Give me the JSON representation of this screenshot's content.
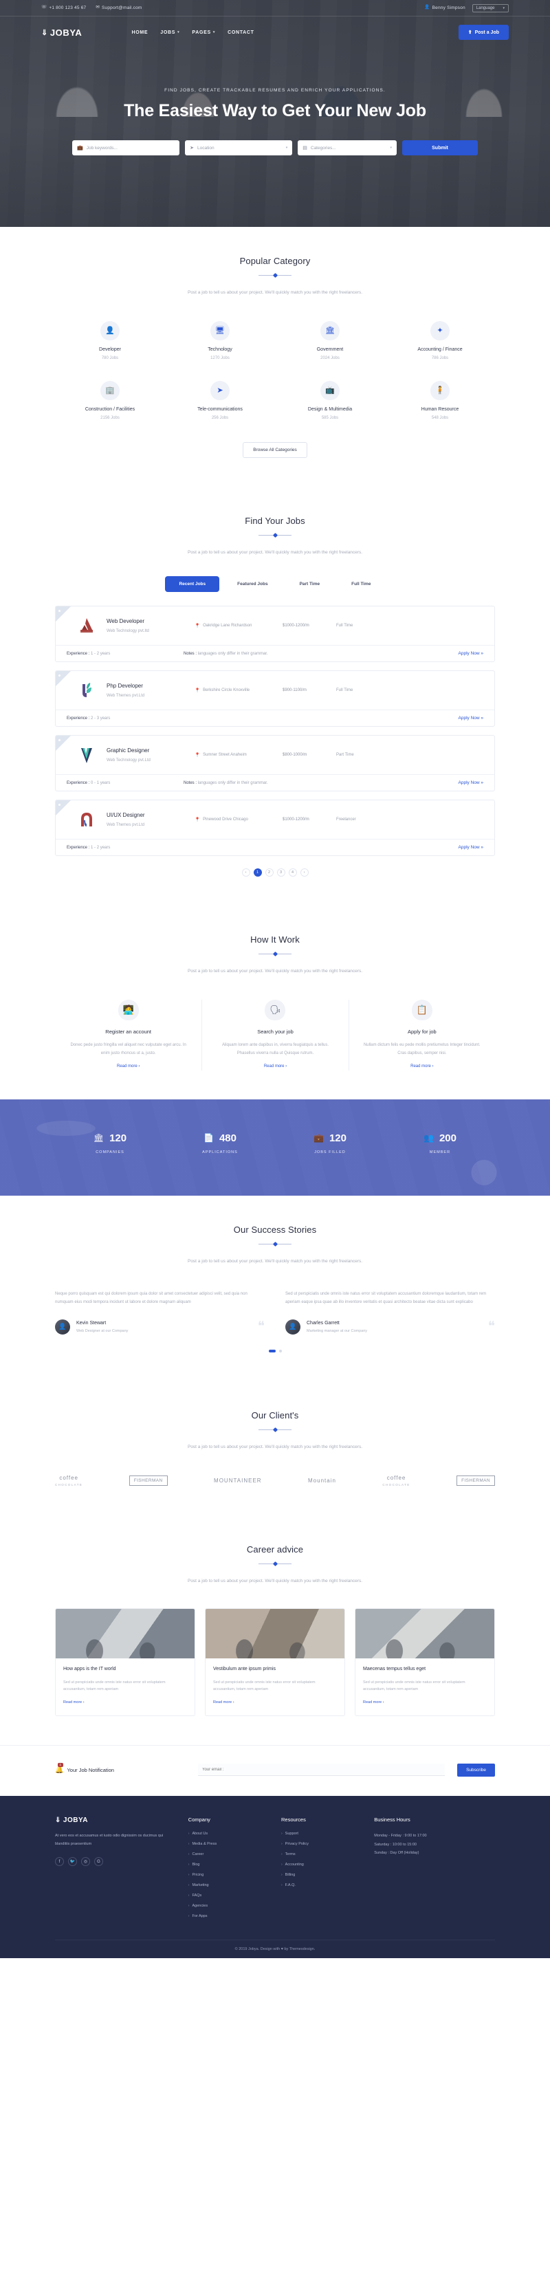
{
  "topbar": {
    "phone": "+1 800 123 45 67",
    "email": "Support@mail.com",
    "user": "Benny Simpson",
    "language": "Language"
  },
  "nav": {
    "brand": "JOBYA",
    "items": [
      {
        "label": "HOME",
        "has_caret": false
      },
      {
        "label": "JOBS",
        "has_caret": true
      },
      {
        "label": "PAGES",
        "has_caret": true
      },
      {
        "label": "CONTACT",
        "has_caret": false
      }
    ],
    "post_job": "Post a Job"
  },
  "hero": {
    "eyebrow": "FIND JOBS, CREATE TRACKABLE RESUMES AND ENRICH YOUR APPLICATIONS.",
    "title": "The Easiest Way to Get Your New Job",
    "search": {
      "keyword_placeholder": "Job keywords...",
      "location_placeholder": "Location",
      "category_placeholder": "Categories...",
      "submit": "Submit"
    }
  },
  "categories": {
    "title": "Popular Category",
    "subtitle": "Post a job to tell us about your project. We'll quickly match you with the right freelancers.",
    "browse_label": "Browse All Categories",
    "items": [
      {
        "name": "Developer",
        "count": "780 Jobs",
        "icon": "user-icon"
      },
      {
        "name": "Technology",
        "count": "1270 Jobs",
        "icon": "laptop-icon"
      },
      {
        "name": "Government",
        "count": "2024 Jobs",
        "icon": "bank-icon"
      },
      {
        "name": "Accounting / Finance",
        "count": "786 Jobs",
        "icon": "wand-icon"
      },
      {
        "name": "Construction / Facilities",
        "count": "2156 Jobs",
        "icon": "building-icon"
      },
      {
        "name": "Tele-communications",
        "count": "256 Jobs",
        "icon": "paper-plane-icon"
      },
      {
        "name": "Design & Multimedia",
        "count": "585 Jobs",
        "icon": "tv-icon"
      },
      {
        "name": "Human Resource",
        "count": "548 Jobs",
        "icon": "accessibility-icon"
      }
    ]
  },
  "jobs": {
    "title": "Find Your Jobs",
    "subtitle": "Post a job to tell us about your project. We'll quickly match you with the right freelancers.",
    "tabs": [
      "Recent Jobs",
      "Featured Jobs",
      "Part Time",
      "Full Time"
    ],
    "active_tab": "Recent Jobs",
    "apply_label": "Apply Now",
    "experience_label": "Experience :",
    "notes_label": "Notes :",
    "items": [
      {
        "title": "Web Developer",
        "company": "Web Technology pvt.ltd",
        "location": "Oakridge Lane Richardson",
        "salary": "$1000-1200/m",
        "type": "Full Time",
        "experience": "1 - 2 years",
        "notes": "languages only differ in their grammar.",
        "logo_color": "#a8403c"
      },
      {
        "title": "Php Developer",
        "company": "Web Themes pvt.Ltd",
        "location": "Berkshire Circle Knoxville",
        "salary": "$900-1100/m",
        "type": "Full Time",
        "experience": "2 - 3 years",
        "notes": "",
        "logo_color": "#3fbfae"
      },
      {
        "title": "Graphic Designer",
        "company": "Web Technology pvt.Ltd",
        "location": "Sumner Street Anaheim",
        "salary": "$800-1000/m",
        "type": "Part Time",
        "experience": "0 - 1 years",
        "notes": "languages only differ in their grammar.",
        "logo_color": "#2c3f63"
      },
      {
        "title": "UI/UX Designer",
        "company": "Web Themes pvt.Ltd",
        "location": "Pinewood Drive Chicago",
        "salary": "$1000-1200/m",
        "type": "Freelancer",
        "experience": "1 - 2 years",
        "notes": "",
        "logo_color": "#b0413e"
      }
    ],
    "pagination": {
      "prev": "‹",
      "next": "›",
      "pages": [
        "1",
        "2",
        "3",
        "4"
      ],
      "active": "1"
    }
  },
  "how": {
    "title": "How It Work",
    "subtitle": "Post a job to tell us about your project. We'll quickly match you with the right freelancers.",
    "read_more": "Read more",
    "items": [
      {
        "title": "Register an account",
        "text": "Donec pede justo fringilla vel aliquet nec vulputate eget arcu. In enim justo rhoncus ut a, justo.",
        "icon": "desk-person-icon"
      },
      {
        "title": "Search your job",
        "text": "Aliquam lorem ante dapibus in, viverra feugiatquis a tellus. Phasellus viverra nulla ut Quisque rutrum.",
        "icon": "interview-icon"
      },
      {
        "title": "Apply for job",
        "text": "Nullam dictum felis eu pede mollis pretiumetus Integer tincidunt. Cras dapibus, semper nisi.",
        "icon": "apply-icon"
      }
    ]
  },
  "counters": [
    {
      "value": "120",
      "label": "COMPANIES",
      "icon": "bank-icon"
    },
    {
      "value": "480",
      "label": "APPLICATIONS",
      "icon": "document-icon"
    },
    {
      "value": "120",
      "label": "JOBS FILLED",
      "icon": "briefcase-icon"
    },
    {
      "value": "200",
      "label": "MEMBER",
      "icon": "people-icon"
    }
  ],
  "testimonials": {
    "title": "Our Success Stories",
    "subtitle": "Post a job to tell us about your project. We'll quickly match you with the right freelancers.",
    "items": [
      {
        "text": "Neque porro quisquam est qui dolorem ipsum quia dolor sit amet consectetuer adipisci velit, sed quia non numquam eius modi tempora incidunt ut labore et dolore magnam aliquam",
        "name": "Kevin Stewart",
        "role": "Web Designer at our Company"
      },
      {
        "text": "Sed ut perspiciatis unde omnis iste natus error sit voluptatem accusantium doloremque laudantium, totam rem aperiam eaque ipsa quae ab illo inventore veritatis et quasi architecto beatae vitae dicta sunt explicabo",
        "name": "Charles Garrett",
        "role": "Marketing manager at our Company"
      }
    ]
  },
  "clients": {
    "title": "Our Client's",
    "subtitle": "Post a job to tell us about your project. We'll quickly match you with the right freelancers.",
    "items": [
      {
        "main": "coffee",
        "sub": "CHOCOLATE",
        "boxed": false
      },
      {
        "main": "FISHERMAN",
        "sub": "",
        "boxed": true
      },
      {
        "main": "MOUNTAINEER",
        "sub": "",
        "boxed": false
      },
      {
        "main": "Mountain",
        "sub": "",
        "boxed": false
      },
      {
        "main": "coffee",
        "sub": "CHOCOLATE",
        "boxed": false
      },
      {
        "main": "FISHERMAN",
        "sub": "",
        "boxed": true
      }
    ]
  },
  "blog": {
    "title": "Career advice",
    "subtitle": "Post a job to tell us about your project. We'll quickly match you with the right freelancers.",
    "read_more": "Read more",
    "items": [
      {
        "title": "How apps is the IT world",
        "text": "Sed ut perspiciatis unde omnis iste natus error sit voluptatem accusantium, totam rem aperiam"
      },
      {
        "title": "Vestibulum ante ipsum primis",
        "text": "Sed ut perspiciatis unde omnis iste natus error sit voluptatem accusantium, totam rem aperiam"
      },
      {
        "title": "Maecenas tempus tellus eget",
        "text": "Sed ut perspiciatis unde omnis iste natus error sit voluptatem accusantium, totam rem aperiam"
      }
    ]
  },
  "newsletter": {
    "label": "Your Job Notification",
    "badge": "1",
    "email_placeholder": "Your email :",
    "subscribe": "Subscribe"
  },
  "footer": {
    "brand": "JOBYA",
    "about": "At vero eos et accusamus et iusto odio dignissim os ducimus qui blanditiis praesentium",
    "social": [
      "facebook-icon",
      "twitter-icon",
      "instagram-icon",
      "google-icon"
    ],
    "columns": [
      {
        "head": "Company",
        "links": [
          "About Us",
          "Media & Press",
          "Career",
          "Blog",
          "Pricing",
          "Marketing",
          "FAQs",
          "Agencies",
          "For Apps"
        ]
      },
      {
        "head": "Resources",
        "links": [
          "Support",
          "Privacy Policy",
          "Terms",
          "Accounting",
          "Billing",
          "F.A.Q."
        ]
      }
    ],
    "hours_head": "Business Hours",
    "hours": [
      "Monday - Friday : 9:00 to 17:00",
      "Saturday : 10:00 to 15:00",
      "Sunday : Day Off (Holiday)"
    ],
    "copyright": "© 2019 Jobya. Design with ♥ by Themesdesign."
  },
  "colors": {
    "accent": "#2b56d4",
    "dark": "#232a48",
    "counter_bg": "#5665bc"
  }
}
